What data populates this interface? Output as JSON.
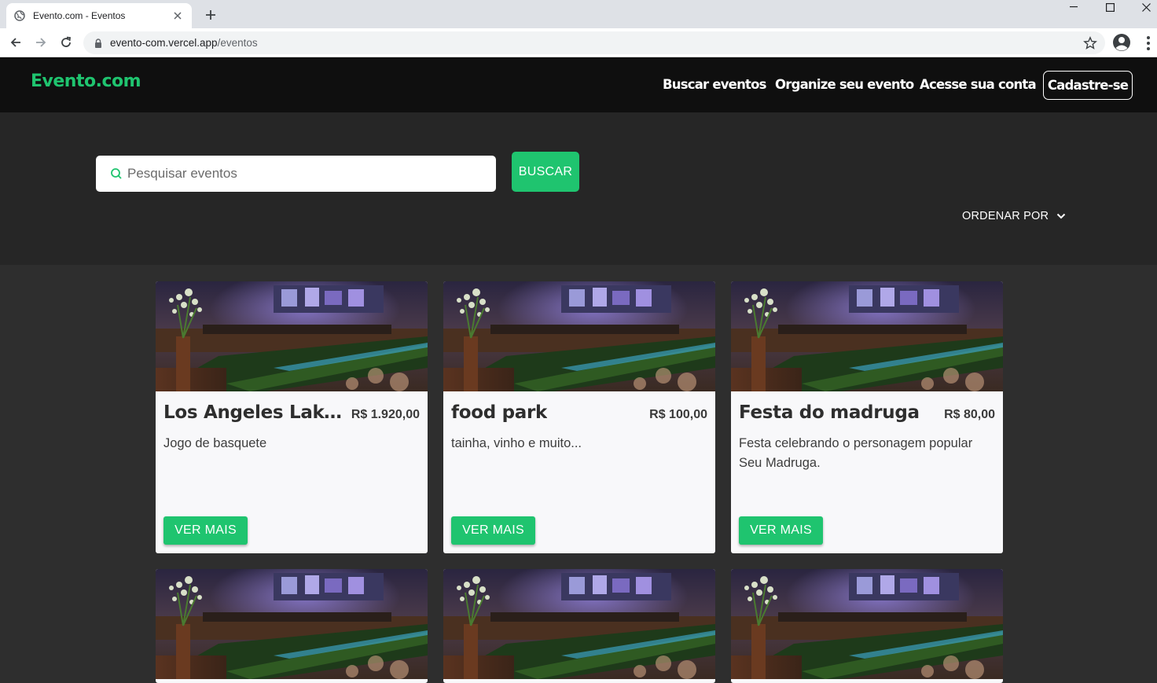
{
  "browser": {
    "tab_title": "Evento.com - Eventos",
    "url_host": "evento-com.vercel.app",
    "url_path": "/eventos"
  },
  "header": {
    "brand": "Evento.com",
    "nav": [
      "Buscar eventos",
      "Organize seu evento",
      "Acesse sua conta"
    ],
    "signup": "Cadastre-se"
  },
  "search": {
    "placeholder": "Pesquisar eventos",
    "button": "BUSCAR",
    "order_by": "ORDENAR POR"
  },
  "cards": [
    {
      "title": "Los Angeles Lakers x Dallas Mavericks",
      "price": "R$ 1.920,00",
      "description": "Jogo de basquete",
      "button": "VER MAIS"
    },
    {
      "title": "food park",
      "price": "R$ 100,00",
      "description": "tainha, vinho e muito...",
      "button": "VER MAIS"
    },
    {
      "title": "Festa do madruga",
      "price": "R$ 80,00",
      "description": "Festa celebrando o personagem popular Seu Madruga.",
      "button": "VER MAIS"
    }
  ],
  "colors": {
    "accent": "#1fc46f",
    "header_bg": "#0f0f0f",
    "search_bg": "#262626",
    "page_bg": "#2e2e2e"
  }
}
